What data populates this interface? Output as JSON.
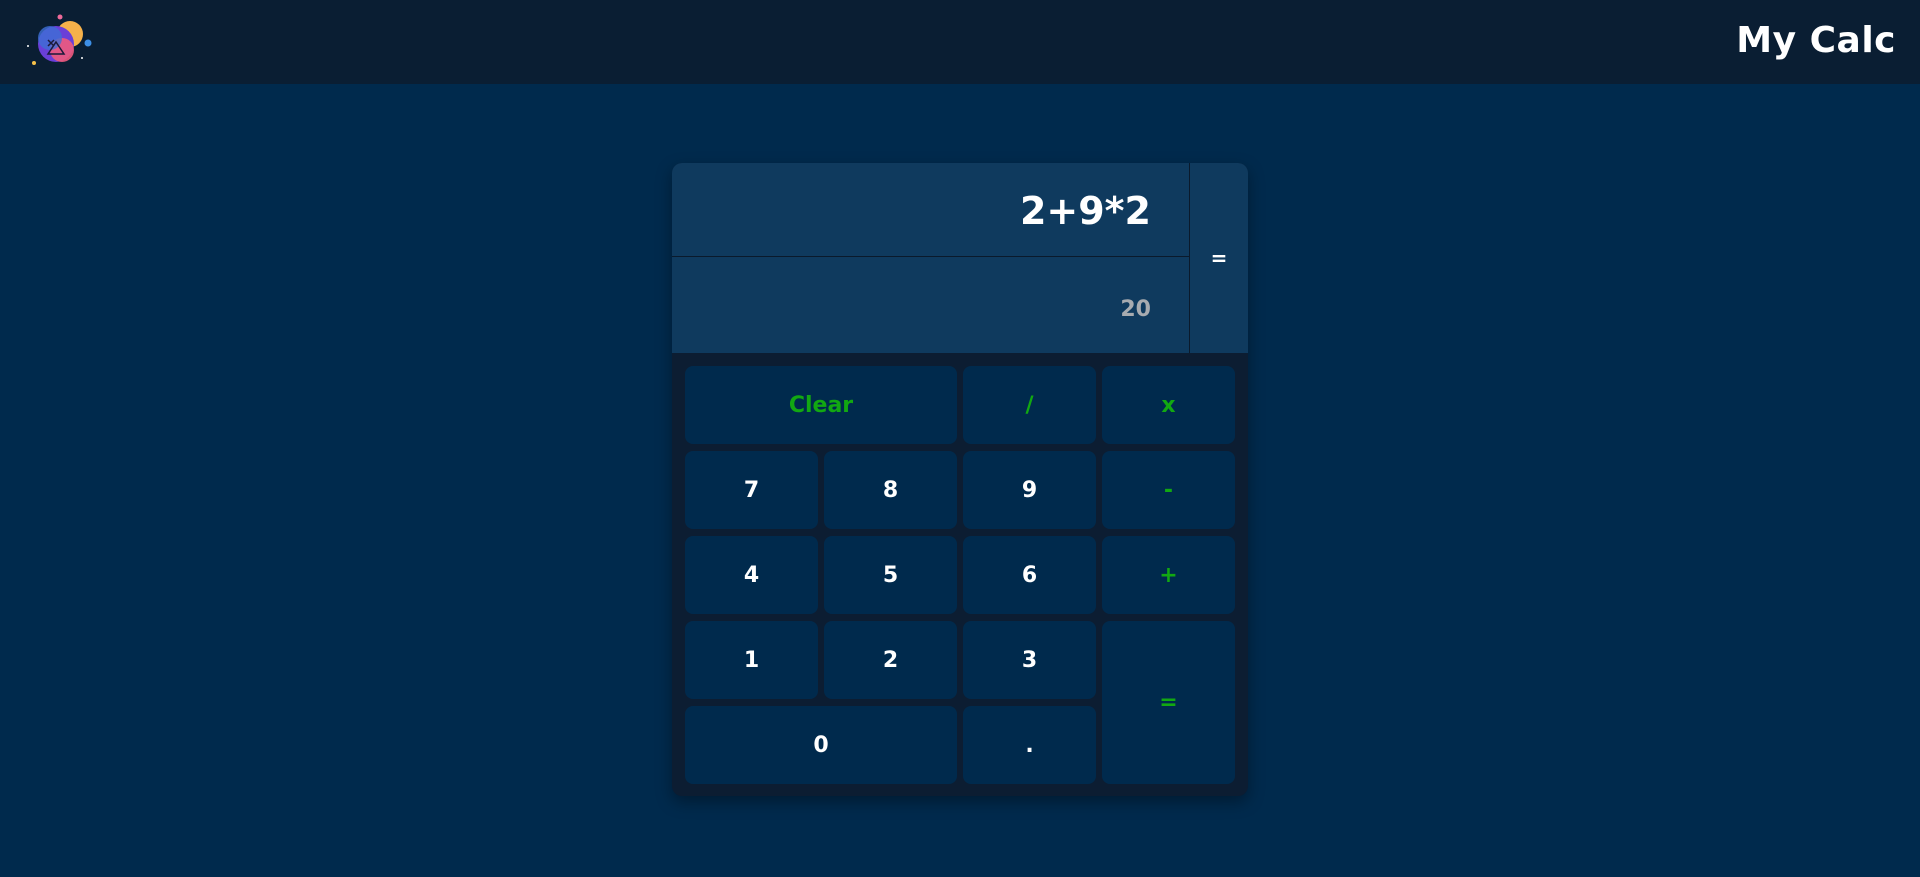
{
  "header": {
    "title": "My Calc",
    "logo_icon": "app-logo-icon"
  },
  "display": {
    "expression": "2+9*2",
    "result": "20",
    "equals_label": "="
  },
  "keys": {
    "clear": "Clear",
    "divide": "/",
    "multiply": "x",
    "seven": "7",
    "eight": "8",
    "nine": "9",
    "minus": "-",
    "four": "4",
    "five": "5",
    "six": "6",
    "plus": "+",
    "one": "1",
    "two": "2",
    "three": "3",
    "equals": "=",
    "zero": "0",
    "dot": "."
  },
  "colors": {
    "page_background": "#002a4d",
    "header_background": "#0a1e33",
    "display_background": "#0f3a5e",
    "operator_text": "#12a812",
    "result_text": "#a7abb0"
  }
}
